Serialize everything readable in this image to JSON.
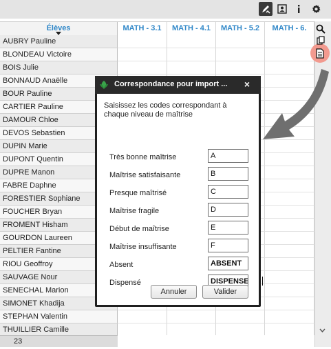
{
  "toolbar": {
    "icons": [
      "pen-check-icon",
      "id-card-icon",
      "info-icon",
      "gear-icon"
    ],
    "accent": "#3a3a3a"
  },
  "grid": {
    "header": {
      "eleves": "Élèves",
      "columns": [
        "MATH - 3.1",
        "MATH - 4.1",
        "MATH - 5.2",
        "MATH - 6."
      ]
    },
    "students": [
      "AUBRY Pauline",
      "BLONDEAU Victoire",
      "BOIS Julie",
      "BONNAUD Anaëlle",
      "BOUR Pauline",
      "CARTIER Pauline",
      "DAMOUR Chloe",
      "DEVOS Sebastien",
      "DUPIN Marie",
      "DUPONT Quentin",
      "DUPRE Manon",
      "FABRE Daphne",
      "FORESTIER Sophiane",
      "FOUCHER Bryan",
      "FROMENT Hisham",
      "GOURDON Laureen",
      "PELTIER Fantine",
      "RIOU Geoffroy",
      "SAUVAGE Nour",
      "SENECHAL Marion",
      "SIMONET Khadija",
      "STEPHAN Valentin",
      "THUILLIER Camille"
    ],
    "count": "23",
    "header_color": "#2f87c8"
  },
  "sidebar": {
    "icons": [
      "search-icon",
      "copy-icon",
      "document-icon",
      "scroll-down-icon"
    ],
    "highlight_color": "#f29a8f"
  },
  "dialog": {
    "title": "Correspondance pour import ...",
    "close": "×",
    "intro": "Saisissez les codes correspondant à chaque niveau de maîtrise",
    "levels": [
      {
        "label": "Très bonne maîtrise",
        "value": "A"
      },
      {
        "label": "Maîtrise satisfaisante",
        "value": "B"
      },
      {
        "label": "Presque maîtrisé",
        "value": "C"
      },
      {
        "label": "Maîtrise fragile",
        "value": "D"
      },
      {
        "label": "Début de maîtrise",
        "value": "E"
      },
      {
        "label": "Maîtrise insuffisante",
        "value": "F"
      },
      {
        "label": "Absent",
        "value": "ABSENT"
      },
      {
        "label": "Dispensé",
        "value": "DISPENSE"
      }
    ],
    "cancel_label": "Annuler",
    "validate_label": "Valider",
    "title_bg": "#2a2a2a"
  }
}
